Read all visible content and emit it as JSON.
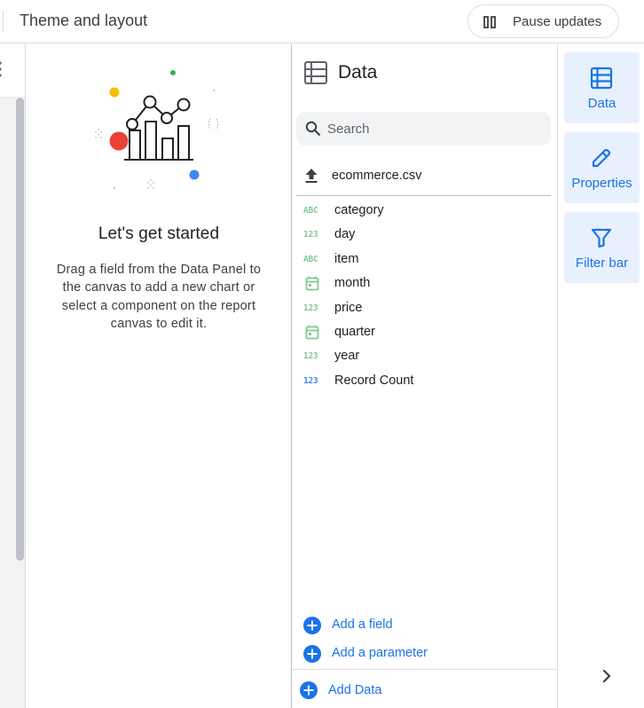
{
  "header": {
    "title": "Theme and layout",
    "pause_label": "Pause updates"
  },
  "theme_panel": {
    "heading": "Let's get started",
    "description": "Drag a field from the Data Panel to the canvas to add a new chart or select a component on the report canvas to edit it."
  },
  "data_panel": {
    "title": "Data",
    "search_placeholder": "Search",
    "data_source": "ecommerce.csv",
    "fields": [
      {
        "name": "category",
        "type": "text",
        "type_label": "ABC",
        "icon": "text-type-icon"
      },
      {
        "name": "day",
        "type": "number",
        "type_label": "123",
        "icon": "number-type-icon"
      },
      {
        "name": "item",
        "type": "text",
        "type_label": "ABC",
        "icon": "text-type-icon"
      },
      {
        "name": "month",
        "type": "date",
        "type_label": "",
        "icon": "date-type-icon"
      },
      {
        "name": "price",
        "type": "number",
        "type_label": "123",
        "icon": "number-type-icon"
      },
      {
        "name": "quarter",
        "type": "date",
        "type_label": "",
        "icon": "date-type-icon"
      },
      {
        "name": "year",
        "type": "number",
        "type_label": "123",
        "icon": "number-type-icon"
      },
      {
        "name": "Record Count",
        "type": "metric",
        "type_label": "123",
        "icon": "metric-type-icon"
      }
    ],
    "add_field": "Add a field",
    "add_parameter": "Add a parameter",
    "add_data": "Add Data"
  },
  "rail": {
    "tabs": [
      {
        "label": "Data",
        "icon": "data-table-icon"
      },
      {
        "label": "Properties",
        "icon": "pencil-icon"
      },
      {
        "label": "Filter bar",
        "icon": "filter-icon"
      }
    ]
  },
  "colors": {
    "accent": "#1a73e8",
    "tab_bg": "#e8f0fe",
    "dimension_green": "#81c995",
    "metric_blue": "#4285f4"
  }
}
